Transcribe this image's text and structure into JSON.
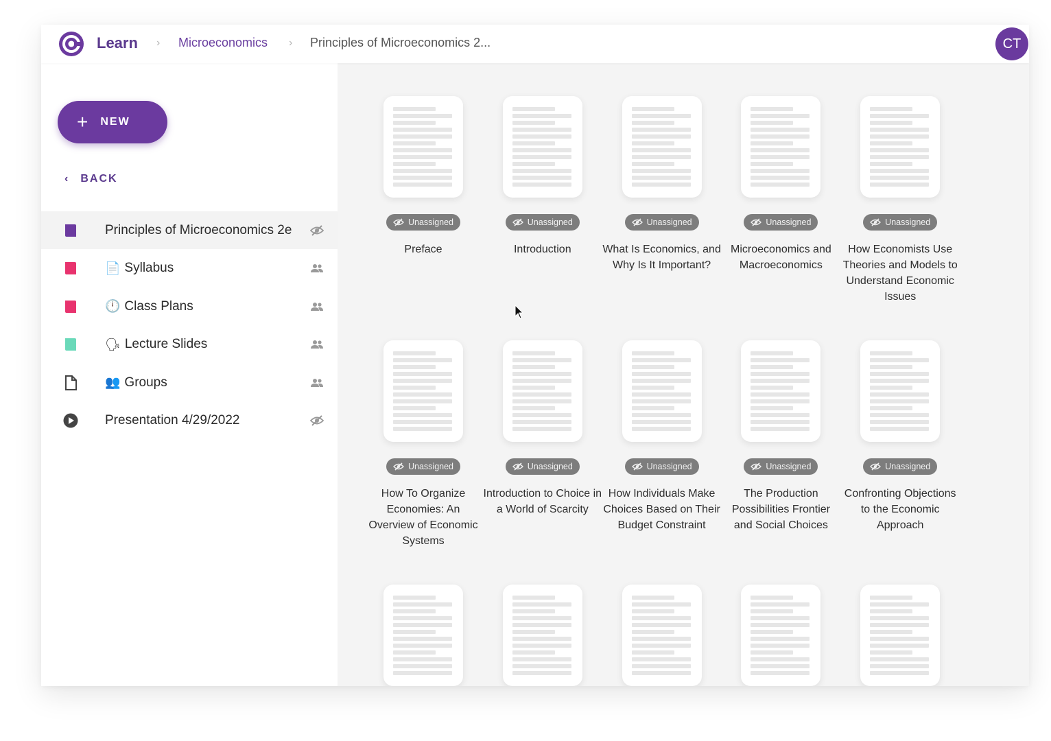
{
  "header": {
    "app_name": "Learn",
    "breadcrumb": [
      "Microeconomics",
      "Principles of Microeconomics 2..."
    ],
    "avatar_initials": "CT",
    "logo_icon": "learn-logo-icon",
    "accent_color": "#6b3a9f"
  },
  "sidebar": {
    "new_label": "NEW",
    "back_label": "BACK",
    "items": [
      {
        "label": "Principles of Microeconomics 2e",
        "emoji": "",
        "icon": "book-icon",
        "icon_color": "#6b3a9f",
        "trail_icon": "eye-off-icon",
        "active": true
      },
      {
        "label": "Syllabus",
        "emoji": "📄",
        "icon": "book-icon",
        "icon_color": "#e8336e",
        "trail_icon": "people-icon",
        "active": false
      },
      {
        "label": "Class Plans",
        "emoji": "🕛",
        "icon": "book-icon",
        "icon_color": "#e8336e",
        "trail_icon": "people-icon",
        "active": false
      },
      {
        "label": "Lecture Slides",
        "emoji": "🗣",
        "icon": "book-icon",
        "icon_color": "#6ad9b9",
        "trail_icon": "people-icon",
        "active": false
      },
      {
        "label": "Groups",
        "emoji": "👥",
        "icon": "document-icon",
        "icon_color": "#444444",
        "trail_icon": "people-icon",
        "active": false
      },
      {
        "label": "Presentation 4/29/2022",
        "emoji": "",
        "icon": "play-circle-icon",
        "icon_color": "#444444",
        "trail_icon": "eye-off-icon",
        "active": false
      }
    ]
  },
  "content": {
    "badge_label": "Unassigned",
    "cards": [
      {
        "title": "Preface"
      },
      {
        "title": "Introduction"
      },
      {
        "title": "What Is Economics, and Why Is It Important?"
      },
      {
        "title": "Microeconomics and Macroeconomics"
      },
      {
        "title": "How Economists Use Theories and Models to Understand Economic Issues"
      },
      {
        "title": "How To Organize Economies: An Overview of Economic Systems"
      },
      {
        "title": "Introduction to Choice in a World of Scarcity"
      },
      {
        "title": "How Individuals Make Choices Based on Their Budget Constraint"
      },
      {
        "title": "The Production Possibilities Frontier and Social Choices"
      },
      {
        "title": "Confronting Objections to the Economic Approach"
      },
      {
        "title": ""
      },
      {
        "title": ""
      },
      {
        "title": ""
      },
      {
        "title": ""
      },
      {
        "title": ""
      }
    ]
  }
}
